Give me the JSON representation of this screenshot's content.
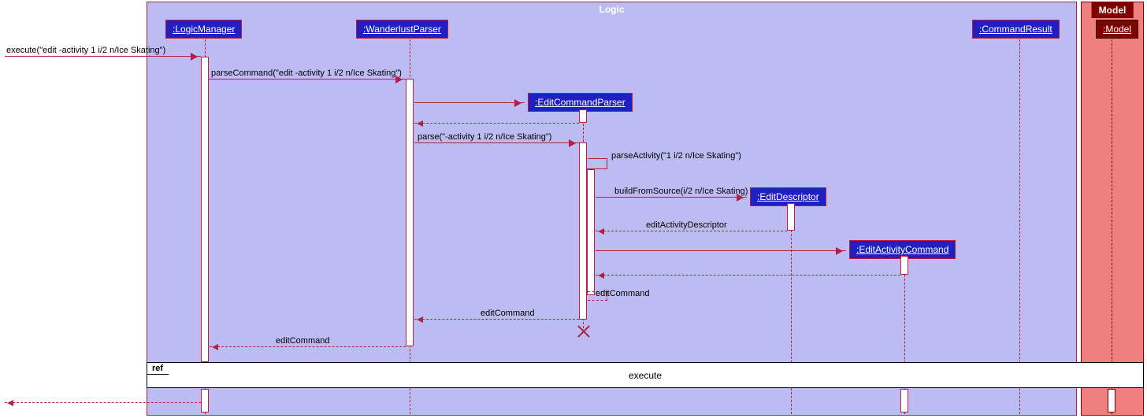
{
  "frames": {
    "logic": {
      "label": "Logic"
    },
    "model": {
      "label": "Model"
    }
  },
  "participants": {
    "logicManager": ":LogicManager",
    "wanderlustParser": ":WanderlustParser",
    "editCommandParser": ":EditCommandParser",
    "editDescriptor": ":EditDescriptor",
    "editActivityCommand": ":EditActivityCommand",
    "commandResult": ":CommandResult",
    "model": ":Model"
  },
  "messages": {
    "m_execute_in": "execute(\"edit -activity 1 i/2 n/Ice Skating\")",
    "m_parseCommand": "parseCommand(\"edit -activity 1 i/2 n/Ice Skating\")",
    "m_parse": "parse(\"-activity 1 i/2 n/Ice Skating\")",
    "m_parseActivity": "parseActivity(\"1 i/2 n/Ice Skating\")",
    "m_buildFromSource": "buildFromSource(i/2 n/Ice Skating)",
    "m_editActivityDescriptor": "editActivityDescriptor",
    "m_editCommand1": "editCommand",
    "m_editCommand2": "editCommand",
    "m_editCommand3": "editCommand"
  },
  "ref": {
    "tab": "ref",
    "body": "execute"
  }
}
